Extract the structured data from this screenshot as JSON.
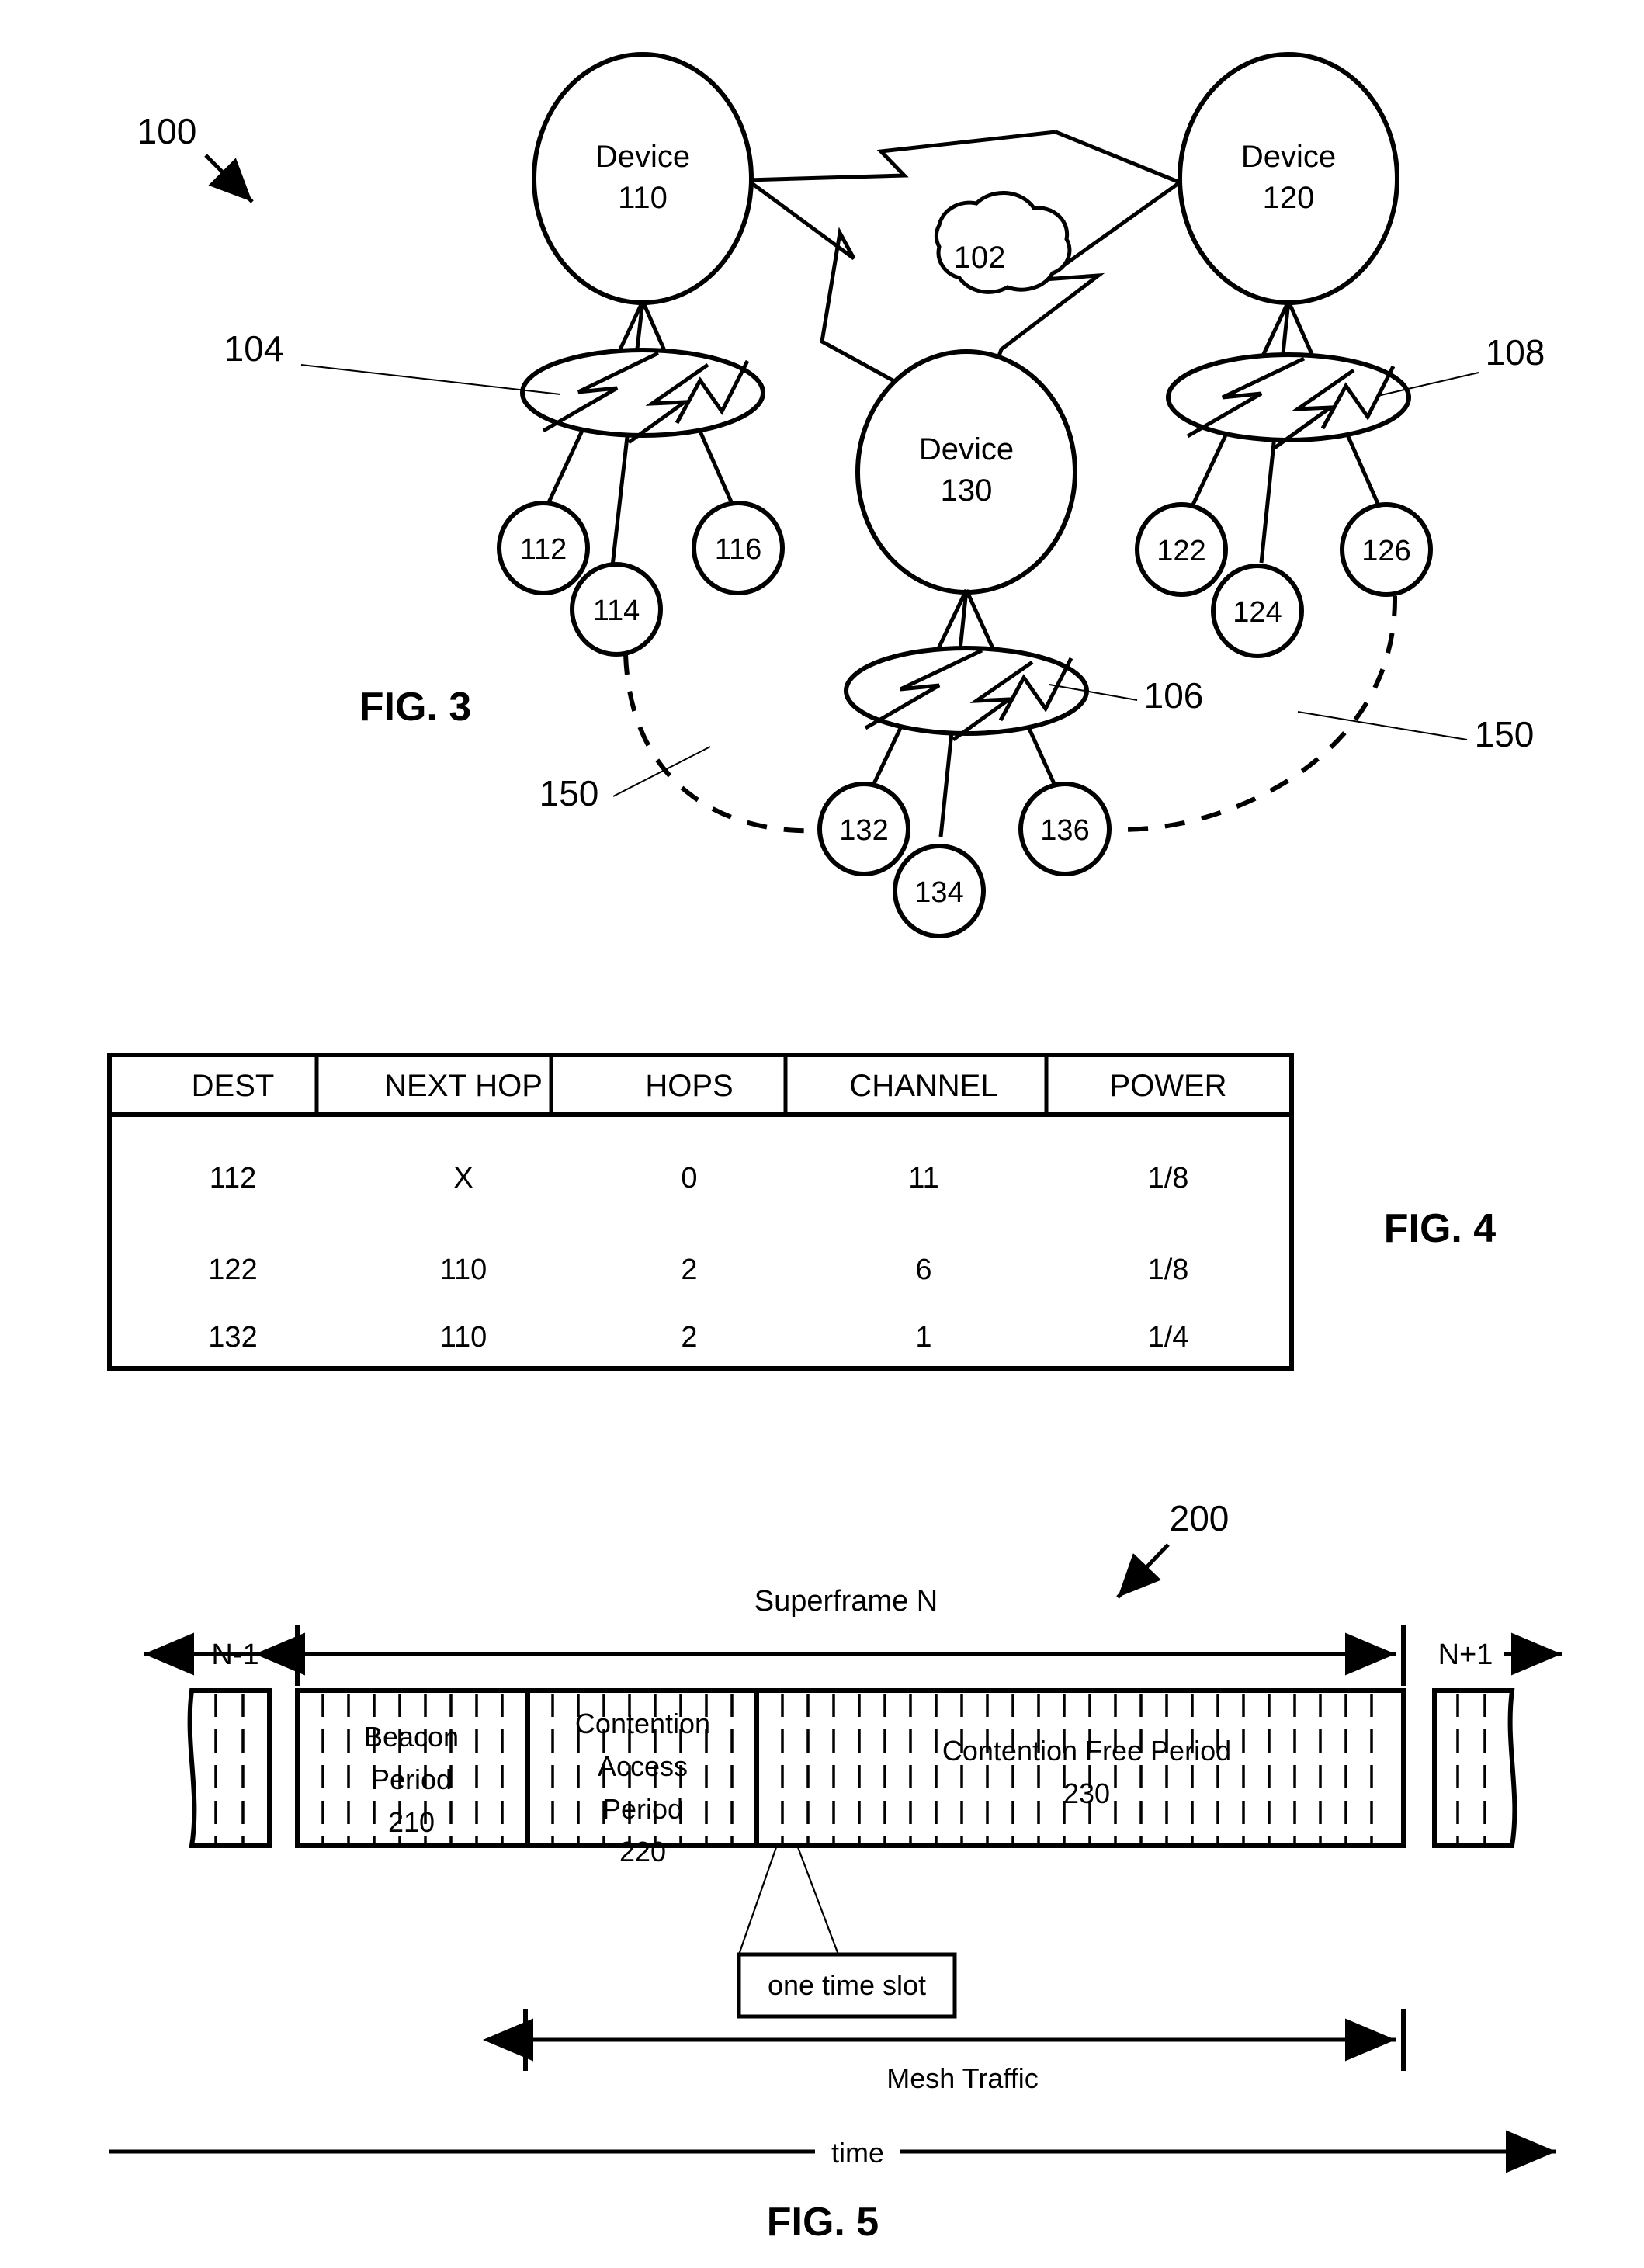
{
  "figures": {
    "fig3": {
      "caption": "FIG. 3",
      "system_ref": "100",
      "cloud_label": "102",
      "devices": [
        {
          "name": "Device",
          "id": "110"
        },
        {
          "name": "Device",
          "id": "120"
        },
        {
          "name": "Device",
          "id": "130"
        }
      ],
      "cluster_refs": [
        "104",
        "106",
        "108"
      ],
      "cluster_104_nodes": [
        "112",
        "114",
        "116"
      ],
      "cluster_106_nodes": [
        "132",
        "134",
        "136"
      ],
      "cluster_108_nodes": [
        "122",
        "124",
        "126"
      ],
      "path_refs": [
        "150",
        "150"
      ]
    },
    "fig4": {
      "caption": "FIG. 4",
      "table": {
        "columns": [
          "DEST",
          "NEXT HOP",
          "HOPS",
          "CHANNEL",
          "POWER"
        ],
        "rows": [
          [
            "112",
            "X",
            "0",
            "11",
            "1/8"
          ],
          [
            "122",
            "110",
            "2",
            "6",
            "1/8"
          ],
          [
            "132",
            "110",
            "2",
            "1",
            "1/4"
          ]
        ]
      }
    },
    "fig5": {
      "caption": "FIG. 5",
      "superframe_ref": "200",
      "title": "Superframe N",
      "prev_frame": "N-1",
      "next_frame": "N+1",
      "segments": [
        {
          "line1": "Beacon",
          "line2": "Period",
          "ref": "210"
        },
        {
          "line1": "Contention",
          "line2": "Access",
          "line3": "Period",
          "ref": "220"
        },
        {
          "line1": "Contention Free Period",
          "ref": "230"
        }
      ],
      "slot_callout": "one time slot",
      "mesh_traffic_label": "Mesh Traffic",
      "time_axis_label": "time"
    }
  },
  "colors": {
    "ink": "#000000",
    "paper": "#ffffff"
  }
}
